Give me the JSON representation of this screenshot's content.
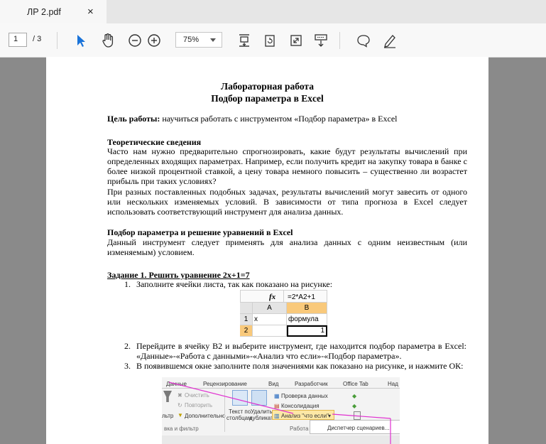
{
  "tab": {
    "title": "ЛР 2.pdf",
    "close": "×"
  },
  "toolbar": {
    "page_current": "1",
    "page_total": "/ 3",
    "zoom": "75%",
    "icons": [
      "select-arrow-icon",
      "hand-icon",
      "zoom-out-icon",
      "zoom-in-icon",
      "fit-page-icon",
      "rotate-icon",
      "fullscreen-icon",
      "scroll-mode-icon",
      "comment-icon",
      "draw-icon"
    ]
  },
  "doc": {
    "title1": "Лабораторная работа",
    "title2": "Подбор параметра в Excel",
    "goal_label": "Цель работы:",
    "goal_text": " научиться работать с инструментом «Подбор параметра» в Excel",
    "theory_heading": "Теоретические сведения",
    "theory_p1": "Часто нам нужно предварительно спрогнозировать, какие будут результаты вычислений при определенных входящих параметрах. Например, если получить кредит на закупку товара в банке с более низкой процентной ставкой, а цену товара немного повысить – существенно ли возрастет прибыль при таких условиях?",
    "theory_p2": "При разных поставленных подобных задачах, результаты вычислений могут завесить от одного или нескольких изменяемых условий. В зависимости от типа прогноза в Excel следует использовать соответствующий инструмент для анализа данных.",
    "section_heading": "Подбор параметра и решение уравнений в Excel",
    "section_p": "Данный инструмент следует применять для анализа данных с одним неизвестным (или изменяемым) условием.",
    "task_heading": "Задание 1. Решить уравнение 2х+1=7",
    "step1_num": "1.",
    "step1": "Заполните ячейки листа, так как показано на рисунке:",
    "step2_num": "2.",
    "step2": "Перейдите в ячейку B2 и выберите инструмент, где находится подбор параметра в Excel: «Данные»-«Работа с данными»-«Анализ что если»-«Подбор параметра».",
    "step3_num": "3.",
    "step3": "В появившемся окне заполните поля значениями как показано на рисунке, и нажмите ОК:"
  },
  "excel1": {
    "fx": "fx",
    "formula": "=2*A2+1",
    "col_a": "A",
    "col_b": "B",
    "row1": "1",
    "row2": "2",
    "a1": "x",
    "b1": "формула",
    "b2": "1"
  },
  "ribbon": {
    "tabs": [
      "Данные",
      "Рецензирование",
      "Вид",
      "Разработчик",
      "Office Tab",
      "Над"
    ],
    "clear": "Очистить",
    "reapply": "Повторить",
    "filter_prefix": "льтр",
    "advanced": "Дополнительно",
    "group_sort": "вка и фильтр",
    "text_to_columns_1": "Текст по",
    "text_to_columns_2": "столбцам",
    "remove_dup_1": "Удалить",
    "remove_dup_2": "дубликаты",
    "validation": "Проверка данных",
    "consolidate": "Консолидация",
    "whatif": "Анализ \"что если\"",
    "group_data": "Работа",
    "scenario_mgr": "Диспетчер сценариев..."
  }
}
